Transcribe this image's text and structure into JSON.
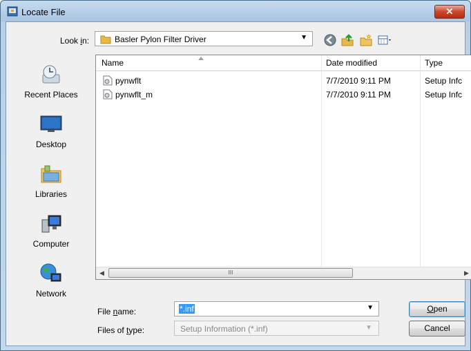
{
  "window": {
    "title": "Locate File",
    "close_glyph": "✕"
  },
  "toolbar": {
    "look_in_label_pre": "Look ",
    "look_in_label_key": "i",
    "look_in_label_post": "n:",
    "look_in_value": "Basler Pylon Filter Driver",
    "icons": [
      "back-icon",
      "up-folder-icon",
      "new-folder-icon",
      "views-menu-icon"
    ]
  },
  "places": [
    {
      "label": "Recent Places",
      "icon": "recent-places-icon"
    },
    {
      "label": "Desktop",
      "icon": "desktop-icon"
    },
    {
      "label": "Libraries",
      "icon": "libraries-icon"
    },
    {
      "label": "Computer",
      "icon": "computer-icon"
    },
    {
      "label": "Network",
      "icon": "network-icon"
    }
  ],
  "file_list": {
    "columns": [
      "Name",
      "Date modified",
      "Type"
    ],
    "rows": [
      {
        "name": "pynwflt",
        "date": "7/7/2010 9:11 PM",
        "type": "Setup Infc"
      },
      {
        "name": "pynwflt_m",
        "date": "7/7/2010 9:11 PM",
        "type": "Setup Infc"
      }
    ],
    "scroll_thumb_grip": "III"
  },
  "filename": {
    "label_pre": "File ",
    "label_key": "n",
    "label_post": "ame:",
    "value": "*.inf"
  },
  "filetype": {
    "label_pre": "Files of ",
    "label_key": "t",
    "label_post": "ype:",
    "value": "Setup Information (*.inf)"
  },
  "buttons": {
    "open_key": "O",
    "open_rest": "pen",
    "cancel": "Cancel"
  }
}
